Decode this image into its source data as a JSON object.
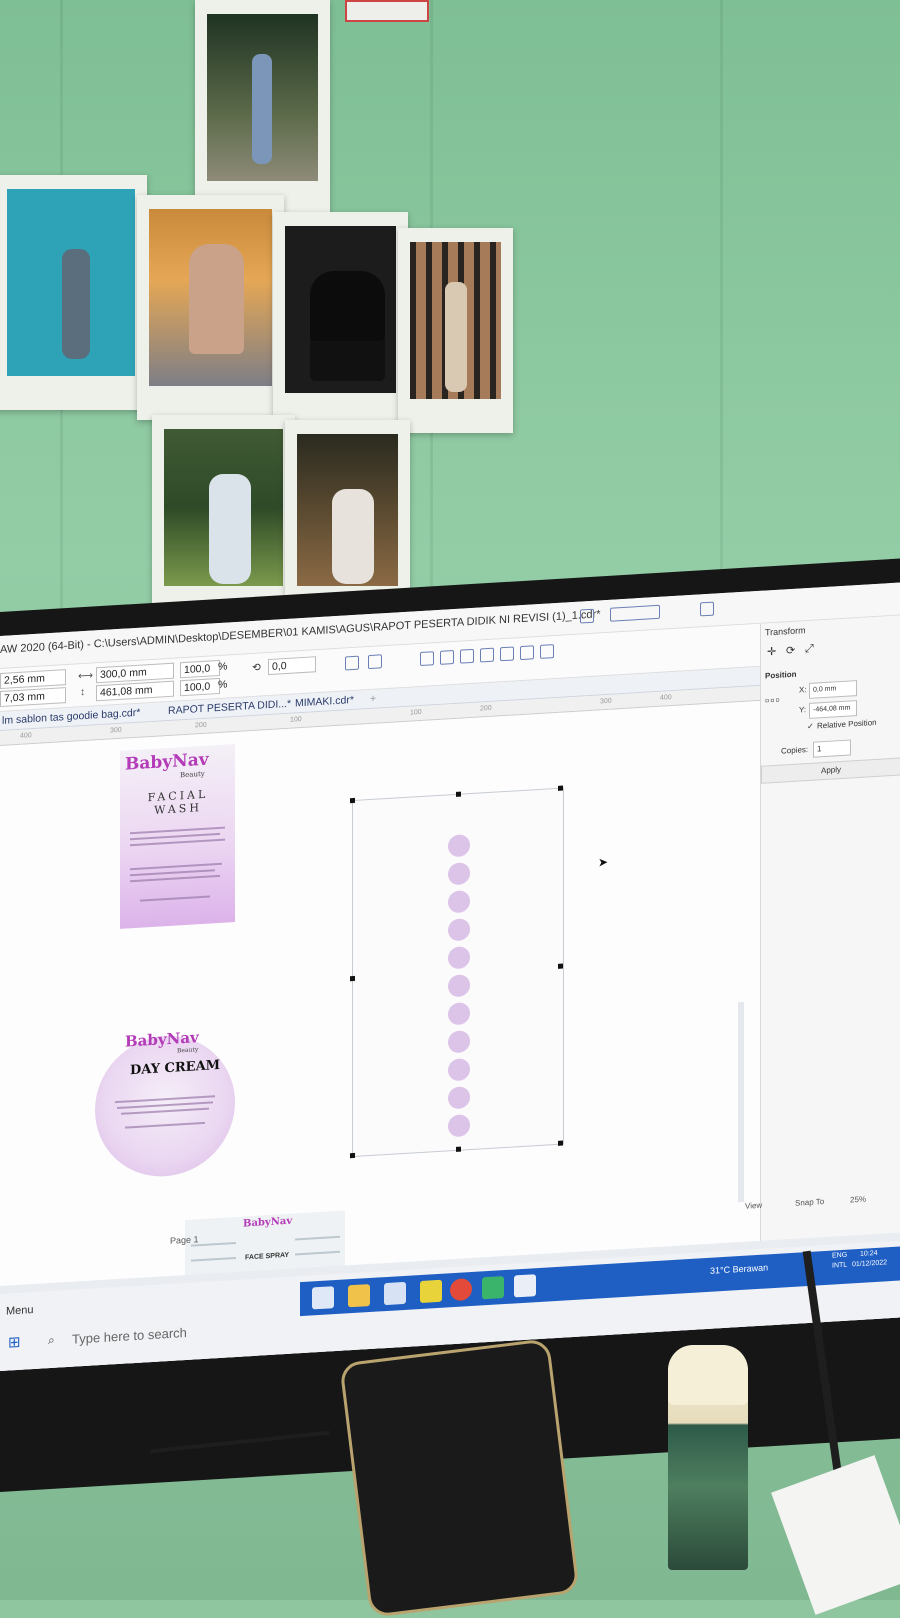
{
  "app": {
    "title": "AW 2020 (64-Bit) - C:\\Users\\ADMIN\\Desktop\\DESEMBER\\01 KAMIS\\AGUS\\RAPOT PESERTA DIDIK NI REVISI (1)_1.cdr*",
    "zoom_field": "0,0",
    "pos_x": "2,56 mm",
    "pos_y": "7,03 mm",
    "width": "300,0 mm",
    "height": "461,08 mm",
    "scale_x": "100,0",
    "scale_y": "100,0",
    "scale_unit": "%"
  },
  "tabs": [
    "lm sablon tas goodie bag.cdr*",
    "RAPOT PESERTA DIDI...*",
    "MIMAKI.cdr*"
  ],
  "ruler_ticks": [
    "400",
    "300",
    "200",
    "100",
    "100",
    "200",
    "300",
    "400"
  ],
  "docker": {
    "title": "Transform",
    "section": "Position",
    "x_label": "X:",
    "x_value": "0,0 mm",
    "y_label": "Y:",
    "y_value": "-464,08 mm",
    "relative_label": "Relative Position",
    "copies_label": "Copies:",
    "copies_value": "1",
    "apply_label": "Apply"
  },
  "labels": {
    "brand": "BabyNav",
    "brand_sub": "Beauty",
    "label1_title": "FACIAL WASH",
    "label2_title": "DAY CREAM",
    "label3_title": "FACE SPRAY"
  },
  "statusbar": {
    "page": "Page 1",
    "view": "View",
    "snap": "Snap To",
    "zoom": "25%"
  },
  "taskbar": {
    "menu": "Menu",
    "search_placeholder": "Type here to search",
    "weather": "31°C  Berawan",
    "lang1": "ENG",
    "lang2": "INTL",
    "time": "10:24",
    "date": "01/12/2022"
  },
  "colors": {
    "brand": "#b43bb8",
    "wall": "#8fc6a0",
    "taskbar_accent": "#1f5fc4"
  }
}
